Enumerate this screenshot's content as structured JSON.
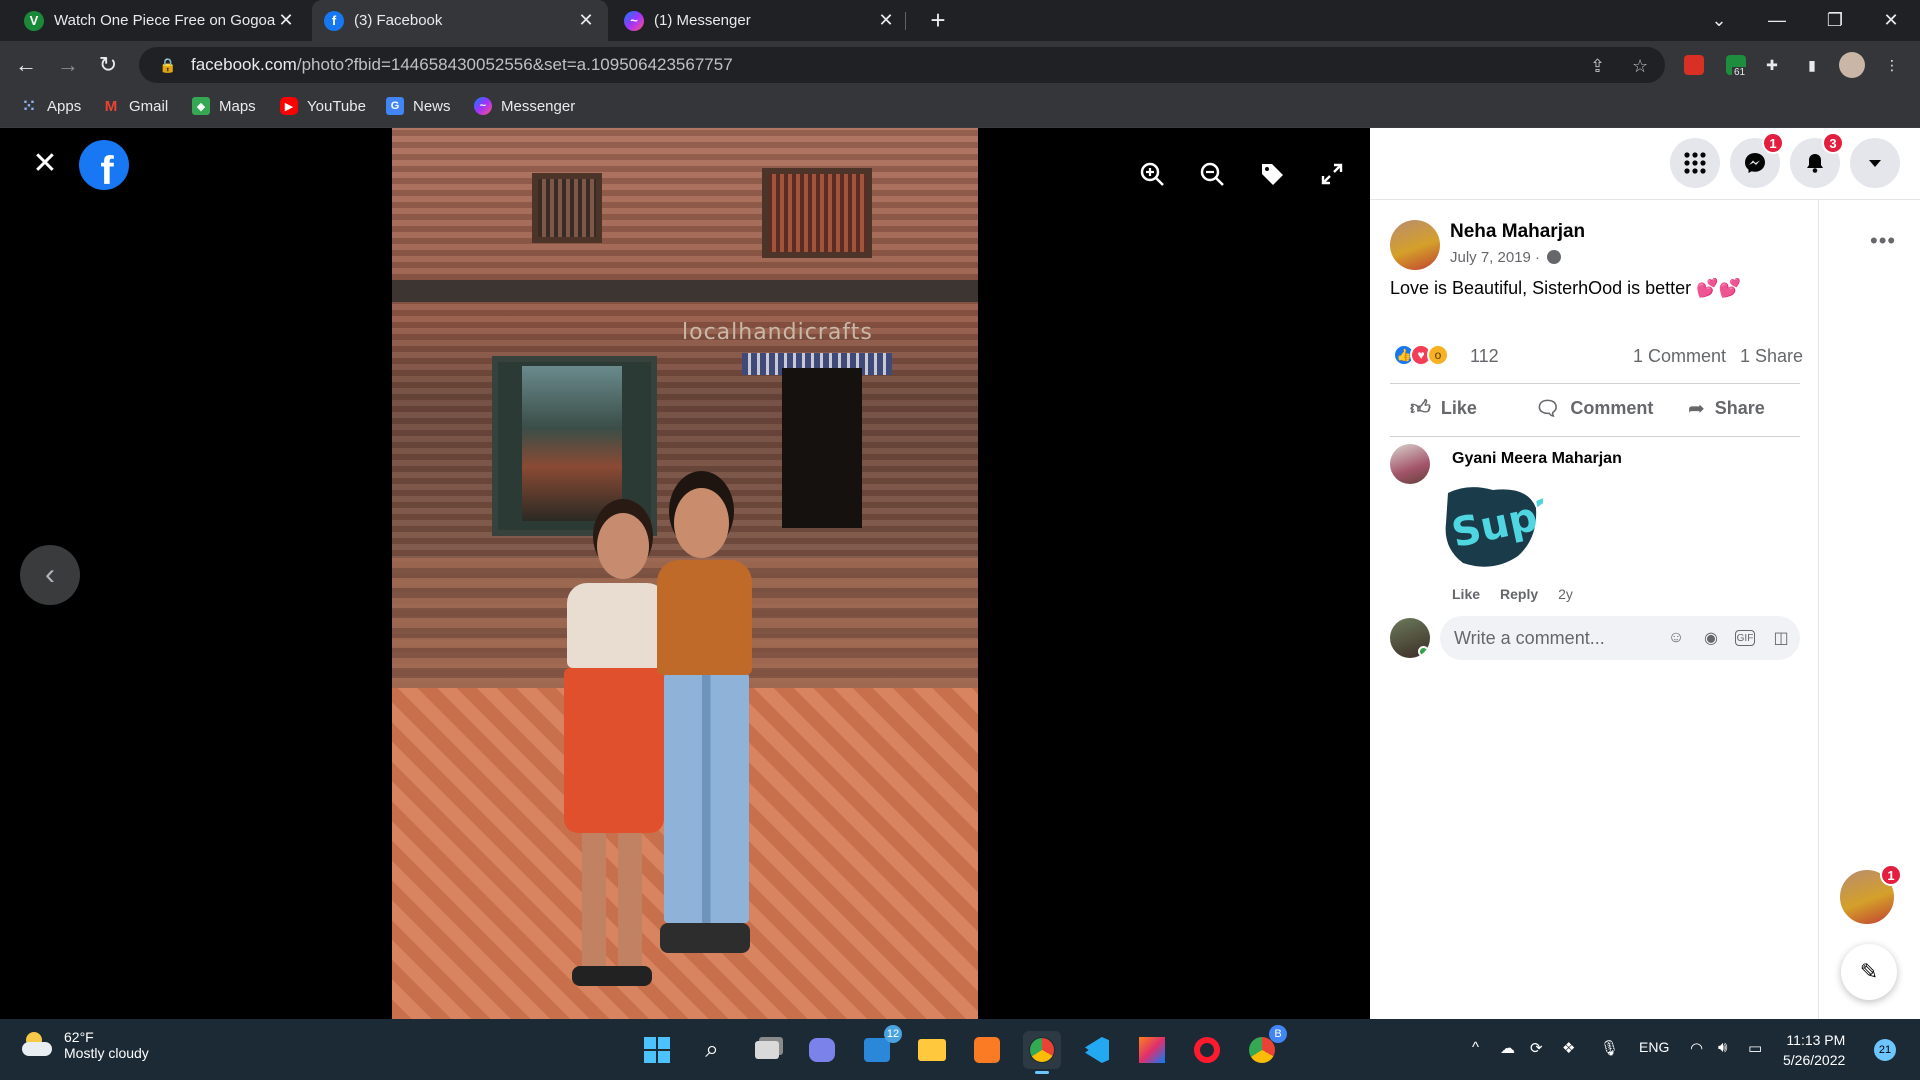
{
  "browser": {
    "tabs": [
      {
        "title": "Watch One Piece Free on Gogoanime",
        "favicon": "gogoanime-icon",
        "active": false
      },
      {
        "title": "(3) Facebook",
        "favicon": "facebook-icon",
        "active": true
      },
      {
        "title": "(1) Messenger",
        "favicon": "messenger-icon",
        "active": false
      }
    ],
    "new_tab": "+",
    "url_host": "facebook.com",
    "url_path": "/photo?fbid=144658430052556&set=a.109506423567757",
    "extension_badge": "61",
    "bookmarks": [
      {
        "label": "Apps",
        "icon": "apps-grid-icon"
      },
      {
        "label": "Gmail",
        "icon": "gmail-icon"
      },
      {
        "label": "Maps",
        "icon": "maps-icon"
      },
      {
        "label": "YouTube",
        "icon": "youtube-icon"
      },
      {
        "label": "News",
        "icon": "news-icon"
      },
      {
        "label": "Messenger",
        "icon": "messenger-icon"
      }
    ]
  },
  "viewer": {
    "photo_sign_text": "localhandicrafts"
  },
  "header": {
    "messenger_badge": "1",
    "notifications_badge": "3"
  },
  "post": {
    "author": "Neha Maharjan",
    "date": "July 7, 2019 ·",
    "text": "Love is Beautiful, SisterhOod is better 💕💕",
    "reaction_count": "112",
    "comment_count": "1 Comment",
    "share_count": "1 Share",
    "actions": {
      "like": "Like",
      "comment": "Comment",
      "share": "Share"
    }
  },
  "comment": {
    "author": "Gyani Meera Maharjan",
    "sticker_text": "Sup?",
    "like": "Like",
    "reply": "Reply",
    "age": "2y"
  },
  "composer": {
    "placeholder": "Write a comment..."
  },
  "chat": {
    "badge": "1"
  },
  "taskbar": {
    "temperature": "62°F",
    "condition": "Mostly cloudy",
    "store_badge": "12",
    "chrome_badge": "B",
    "language": "ENG",
    "time": "11:13 PM",
    "date": "5/26/2022",
    "notification_count": "21"
  },
  "colors": {
    "facebook_blue": "#1877f2",
    "badge_red": "#e41e3f",
    "taskbar_bg": "#1c2a35"
  }
}
